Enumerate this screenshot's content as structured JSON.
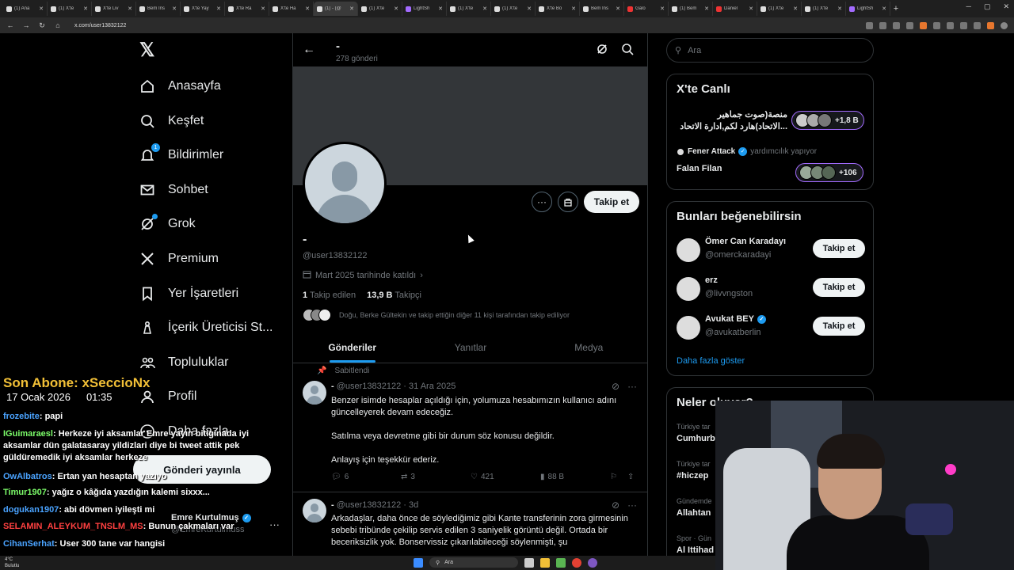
{
  "browser": {
    "tabs": [
      {
        "label": "(1) Ana"
      },
      {
        "label": "(1) X'te"
      },
      {
        "label": "X'te Liv"
      },
      {
        "label": "Bem Ins"
      },
      {
        "label": "X'te Yay"
      },
      {
        "label": "X'te Ra"
      },
      {
        "label": "X'te Ha"
      },
      {
        "label": "(1) - (@"
      },
      {
        "label": "(1) X'te"
      },
      {
        "label": "LightSh"
      },
      {
        "label": "(1) X'te"
      },
      {
        "label": "(1) X'te"
      },
      {
        "label": "X'te Bo"
      },
      {
        "label": "Bem Ins"
      },
      {
        "label": "Galo"
      },
      {
        "label": "(1) Bem"
      },
      {
        "label": "Daniel"
      },
      {
        "label": "(1) X'te"
      },
      {
        "label": "(1) X'te"
      },
      {
        "label": "LightSh"
      }
    ],
    "url": "x.com/user13832122"
  },
  "nav": {
    "items": [
      {
        "label": "Anasayfa",
        "icon": "home-icon"
      },
      {
        "label": "Keşfet",
        "icon": "search-icon"
      },
      {
        "label": "Bildirimler",
        "icon": "bell-icon",
        "badge": "1"
      },
      {
        "label": "Sohbet",
        "icon": "mail-icon"
      },
      {
        "label": "Grok",
        "icon": "grok-icon"
      },
      {
        "label": "Premium",
        "icon": "x-icon"
      },
      {
        "label": "Yer İşaretleri",
        "icon": "bookmark-icon"
      },
      {
        "label": "İçerik Üreticisi St...",
        "icon": "flask-icon"
      },
      {
        "label": "Topluluklar",
        "icon": "people-icon"
      },
      {
        "label": "Profil",
        "icon": "person-icon"
      },
      {
        "label": "Daha fazla",
        "icon": "more-icon"
      }
    ],
    "post_button": "Gönderi yayınla",
    "account": {
      "name": "Emre Kurtulmuş",
      "handle": "@EmreKurtulmuss"
    }
  },
  "profile": {
    "header_name": "-",
    "post_count": "278 gönderi",
    "name": "-",
    "handle": "@user13832122",
    "joined": "Mart 2025 tarihinde katıldı",
    "following_count": "1",
    "following_label": "Takip edilen",
    "followers_count": "13,9 B",
    "followers_label": "Takipçi",
    "followed_by": "Doğu, Berke Gültekin ve takip ettiğin diğer 11 kişi tarafından takip ediliyor",
    "follow_button": "Takip et",
    "tabs": [
      "Gönderiler",
      "Yanıtlar",
      "Medya"
    ]
  },
  "tweets": [
    {
      "pinned": "Sabitlendi",
      "name": "-",
      "meta": "@user13832122 · 31 Ara 2025",
      "paragraphs": [
        "Benzer isimde hesaplar açıldığı için, yolumuza hesabımızın kullanıcı adını güncelleyerek devam edeceğiz.",
        "Satılma veya devretme gibi bir durum söz konusu değildir.",
        "Anlayış için teşekkür ederiz."
      ],
      "replies": "6",
      "reposts": "3",
      "likes": "421",
      "views": "88 B"
    },
    {
      "name": "-",
      "meta": "@user13832122 · 3d",
      "paragraphs": [
        "Arkadaşlar, daha önce de söylediğimiz gibi Kante transferinin zora girmesinin sebebi tribünde çekilip servis edilen 3 saniyelik görüntü değil. Ortada bir beceriksizlik yok. Bonservissiz çıkarılabileceği söylenmişti, şu"
      ]
    }
  ],
  "right": {
    "search_placeholder": "Ara",
    "live": {
      "title": "X'te Canlı",
      "items": [
        {
          "text1": "منصة(صوت جماهير",
          "text2": "الاتحاد)هارد لكم,ادارة الاتحاد...",
          "count": "+1,8 B"
        },
        {
          "host": "Fener Attack",
          "host_suffix": "yardımcılık yapıyor",
          "text1": "Falan Filan",
          "count": "+106"
        }
      ]
    },
    "suggest": {
      "title": "Bunları beğenebilirsin",
      "items": [
        {
          "name": "Ömer Can Karadayı",
          "handle": "@omerckaradayi",
          "verified": false
        },
        {
          "name": "erz",
          "handle": "@livvngston",
          "verified": false
        },
        {
          "name": "Avukat BEY",
          "handle": "@avukatberlin",
          "verified": true
        }
      ],
      "button": "Takip et",
      "more": "Daha fazla göster"
    },
    "trends": {
      "title": "Neler oluyor?",
      "items": [
        {
          "cat": "Türkiye tar",
          "name": "Cumhurb"
        },
        {
          "cat": "Türkiye tar",
          "name": "#hiczep"
        },
        {
          "cat": "Gündemde",
          "name": "Allahtan"
        },
        {
          "cat": "Spor · Gün",
          "name": "Al Ittihad"
        }
      ]
    }
  },
  "overlay": {
    "last_sub": "Son Abone: xSeccioNx",
    "date": "17 Ocak 2026",
    "time": "01:35",
    "chat": [
      {
        "user": "frozebite",
        "msg": "papi",
        "color": "blue"
      },
      {
        "user": "IGuimaraesl",
        "msg": "Herkeze iyi aksamlar Emre yayın bitiginada iyi aksamlar dün galatasaray yildizlari diye bi tweet attik pek güldüremedik iyi aksamlar herkeze",
        "color": "green"
      },
      {
        "user": "OwAlbatros",
        "msg": "Ertan yan hesaptan yazıyo",
        "color": "blue"
      },
      {
        "user": "Timur1907",
        "msg": "yağız o kâğıda yazdığın kalemi sixxx...",
        "color": "green"
      },
      {
        "user": "dogukan1907",
        "msg": "abi dövmen iyileşti mi",
        "color": "blue"
      },
      {
        "user": "SELAMIN_ALEYKUM_TNSLM_MS",
        "msg": "Bunun çakmaları var",
        "color": "red"
      },
      {
        "user": "CihanSerhat",
        "msg": "User 300 tane var hangisi",
        "color": "blue"
      }
    ]
  },
  "taskbar": {
    "weather_temp": "4°C",
    "weather_desc": "Bulutlu",
    "search": "Ara"
  }
}
